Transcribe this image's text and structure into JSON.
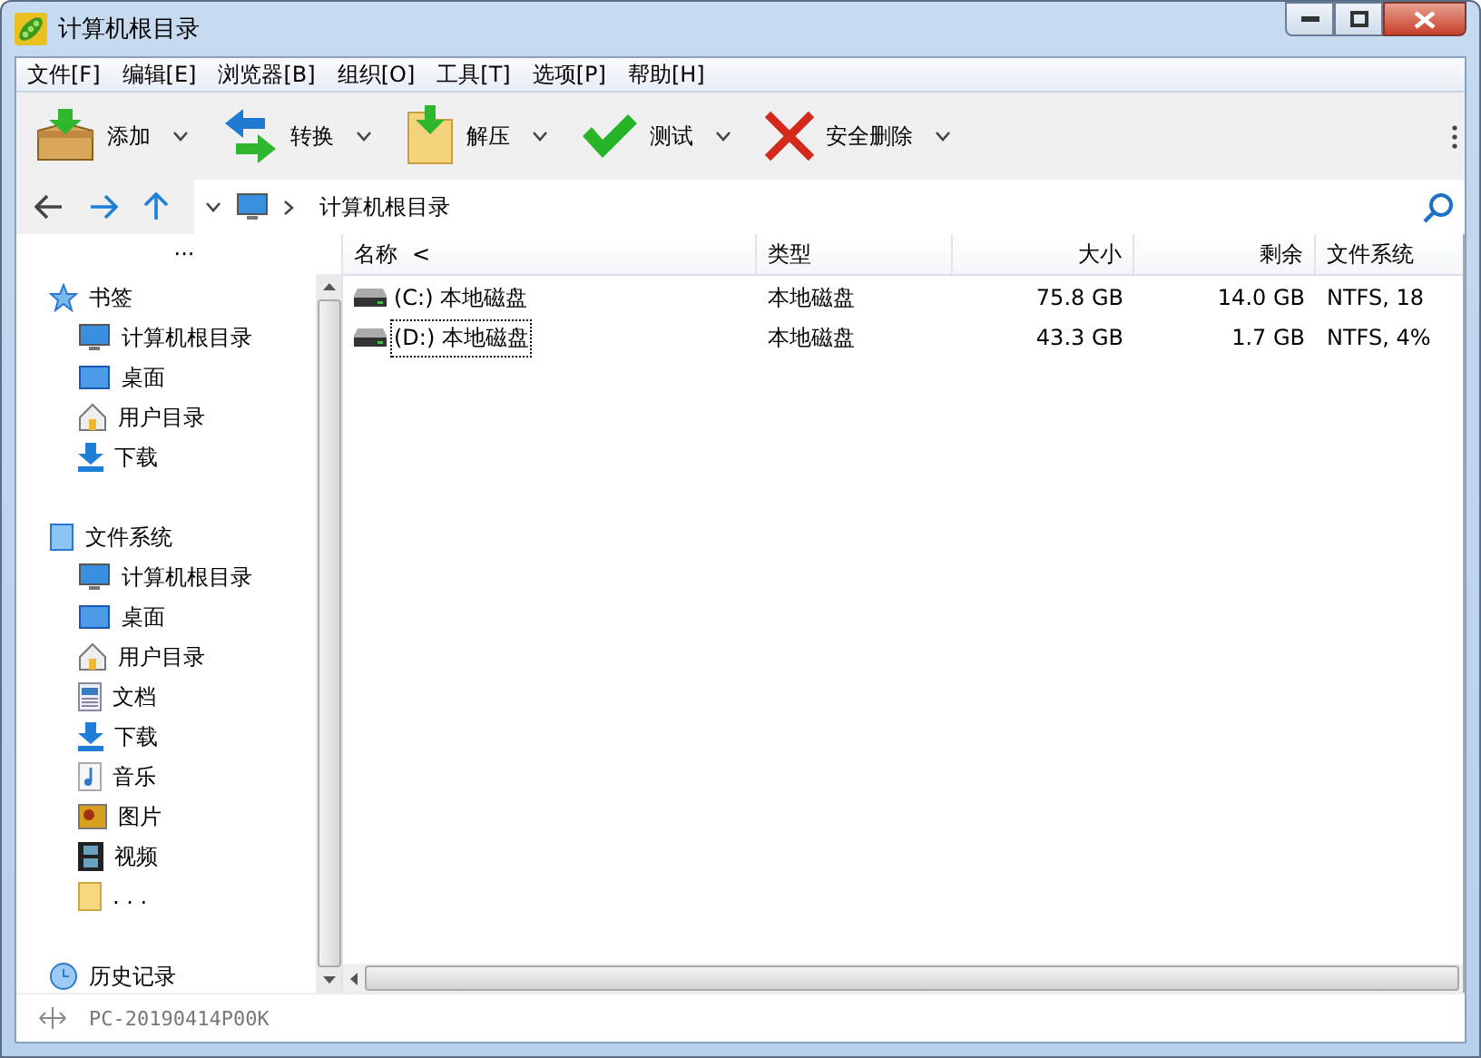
{
  "window": {
    "title": "计算机根目录"
  },
  "menu": [
    "文件[F]",
    "编辑[E]",
    "浏览器[B]",
    "组织[O]",
    "工具[T]",
    "选项[P]",
    "帮助[H]"
  ],
  "toolbar": [
    {
      "label": "添加"
    },
    {
      "label": "转换"
    },
    {
      "label": "解压"
    },
    {
      "label": "测试"
    },
    {
      "label": "安全删除"
    }
  ],
  "address": {
    "path": "计算机根目录"
  },
  "sidebar": {
    "more": "···",
    "sections": [
      {
        "label": "书签",
        "children": [
          {
            "label": "计算机根目录"
          },
          {
            "label": "桌面"
          },
          {
            "label": "用户目录"
          },
          {
            "label": "下载"
          }
        ]
      },
      {
        "label": "文件系统",
        "children": [
          {
            "label": "计算机根目录"
          },
          {
            "label": "桌面"
          },
          {
            "label": "用户目录"
          },
          {
            "label": "文档"
          },
          {
            "label": "下载"
          },
          {
            "label": "音乐"
          },
          {
            "label": "图片"
          },
          {
            "label": "视频"
          },
          {
            "label": ". . ."
          }
        ]
      },
      {
        "label": "历史记录"
      }
    ]
  },
  "table": {
    "columns": [
      {
        "label": "名称",
        "sort": "<"
      },
      {
        "label": "类型"
      },
      {
        "label": "大小"
      },
      {
        "label": "剩余"
      },
      {
        "label": "文件系统"
      }
    ],
    "rows": [
      {
        "name": "(C:) 本地磁盘",
        "type": "本地磁盘",
        "size": "75.8 GB",
        "free": "14.0 GB",
        "fs": "NTFS, 18",
        "focused": false
      },
      {
        "name": "(D:) 本地磁盘",
        "type": "本地磁盘",
        "size": "43.3 GB",
        "free": "1.7 GB",
        "fs": "NTFS, 4%",
        "focused": true
      }
    ]
  },
  "status_bar": {
    "computer": "PC-20190414P00K"
  }
}
